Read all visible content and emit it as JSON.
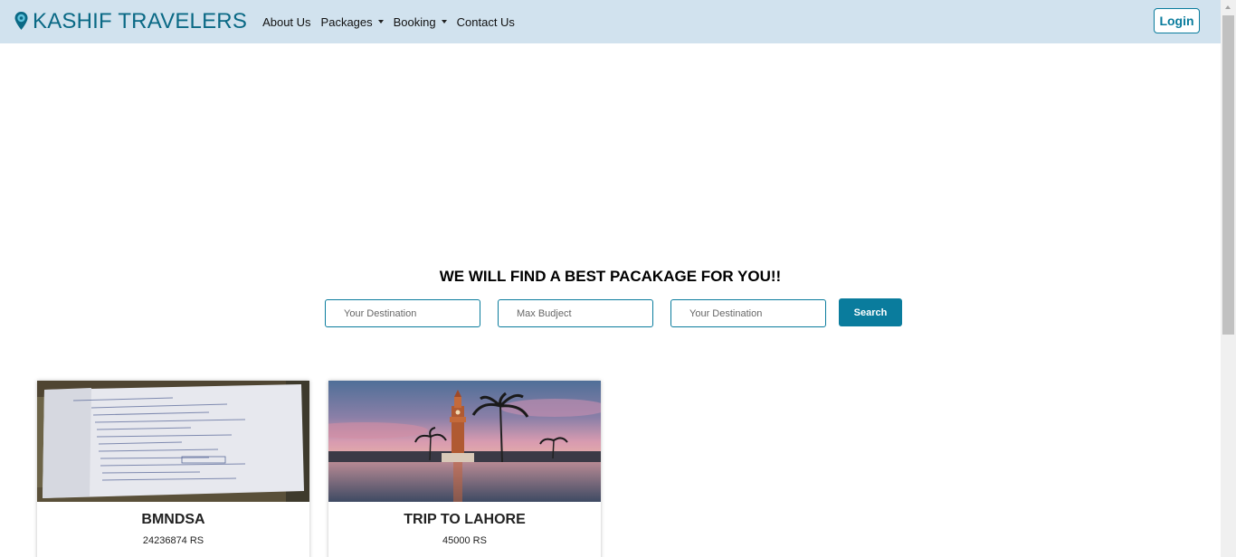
{
  "navbar": {
    "brand": "KASHIF TRAVELERS",
    "links": [
      {
        "label": "About Us",
        "dropdown": false
      },
      {
        "label": "Packages",
        "dropdown": true
      },
      {
        "label": "Booking",
        "dropdown": true
      },
      {
        "label": "Contact Us",
        "dropdown": false
      }
    ],
    "login_label": "Login"
  },
  "search": {
    "heading": "WE WILL FIND A BEST PACAKAGE FOR YOU!!",
    "fields": [
      {
        "placeholder": "Your Destination"
      },
      {
        "placeholder": "Max Budject"
      },
      {
        "placeholder": "Your Destination"
      }
    ],
    "button_label": "Search"
  },
  "packages": [
    {
      "title": "BMNDSA",
      "price": "24236874 RS",
      "image": "handwritten-note-photo"
    },
    {
      "title": "TRIP TO LAHORE",
      "price": "45000 RS",
      "image": "clock-tower-palm-trees-photo"
    }
  ],
  "colors": {
    "navbar_bg": "#d1e2ee",
    "brand": "#0a6985",
    "accent": "#0a7c9d"
  },
  "icons": {
    "brand": "map-pin-icon"
  }
}
